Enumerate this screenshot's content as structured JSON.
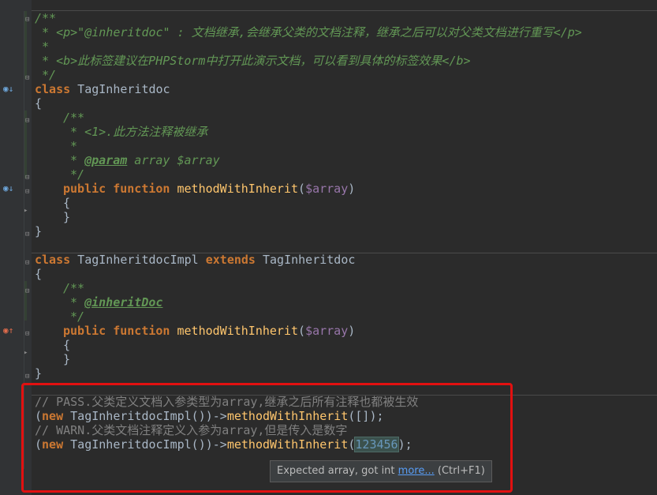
{
  "code": {
    "l1": "/**",
    "l2": " * <p>\"@inheritdoc\" : 文档继承,会继承父类的文档注释，继承之后可以对父类文档进行重写</p>",
    "l3": " *",
    "l4": " * <b>此标签建议在PHPStorm中打开此演示文档，可以看到具体的标签效果</b>",
    "l5": " */",
    "class1_kw": "class",
    "class1_name": " TagInheritdoc",
    "open_brace": "{",
    "close_brace": "}",
    "doc_open": "/**",
    "m1_desc": " * <1>.此方法注释被继承",
    "doc_star": " *",
    "param_tag": "@param",
    "param_rest": " array $array",
    "doc_close": " */",
    "public": "public",
    "function": "function",
    "method_name": "methodWithInherit",
    "param_var": "$array",
    "class2_name": " TagInheritdocImpl ",
    "extends": "extends",
    "parent_name": " TagInheritdoc",
    "inherit_tag": "@inheritDoc",
    "c1": "// PASS.父类定义文档入参类型为array,继承之后所有注释也都被生效",
    "new_kw": "new",
    "impl_call": " TagInheritdocImpl())->",
    "call1_args": "([]);",
    "c2": "// WARN.父类文档注释定义入参为array,但是传入是数字",
    "num": "123456",
    "call2_end": ");"
  },
  "tooltip": {
    "message": "Expected array, got int ",
    "link": "more...",
    "shortcut": " (Ctrl+F1)"
  },
  "colors": {
    "background": "#2b2b2b",
    "keyword": "#cc7832",
    "function": "#ffc66d",
    "doc_comment": "#629755",
    "comment": "#808080",
    "highlight_box": "#e21010"
  },
  "icons": [
    "override-icon",
    "implemented-icon",
    "overriding-icon",
    "fold-icon"
  ]
}
